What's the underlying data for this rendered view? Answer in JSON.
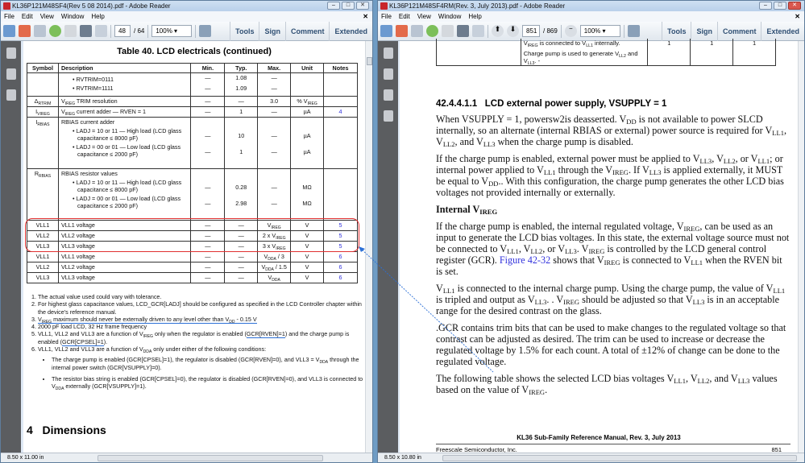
{
  "left_window": {
    "title": "KL36P121M48SF4(Rev 5 08 2014).pdf - Adobe Reader",
    "menu": [
      "File",
      "Edit",
      "View",
      "Window",
      "Help"
    ],
    "page_current": "48",
    "page_total": "/ 64",
    "zoom": "100%",
    "tool_buttons": [
      "Tools",
      "Sign",
      "Comment",
      "Extended"
    ],
    "page_size": "8.50 x 11.00 in",
    "table_title": "Table 40.  LCD electricals (continued)",
    "headers": [
      "Symbol",
      "Description",
      "Min.",
      "Typ.",
      "Max.",
      "Unit",
      "Notes"
    ],
    "rows": [
      {
        "sym": "",
        "desc": [
          "• RVTRIM=0111",
          "• RVTRIM=1111"
        ],
        "min": [
          "—",
          "—"
        ],
        "typ": [
          "1.08",
          "1.09"
        ],
        "max": [
          "—",
          "—"
        ],
        "unit": "",
        "note": ""
      },
      {
        "sym": "Δ_{RTRIM}",
        "desc": [
          "V_{IREG} TRIM resolution"
        ],
        "min": [
          "—"
        ],
        "typ": [
          "—"
        ],
        "max": [
          "3.0"
        ],
        "unit": "% V_{IREG}",
        "note": ""
      },
      {
        "sym": "I_{VIREG}",
        "desc": [
          "V_{IREG} current adder — RVEN = 1"
        ],
        "min": [
          "—"
        ],
        "typ": [
          "1"
        ],
        "max": [
          "—"
        ],
        "unit": "µA",
        "note": "4"
      },
      {
        "sym": "I_{RBIAS}",
        "desc": [
          "RBIAS current adder",
          "• LADJ = 10 or 11 — High load (LCD glass capacitance ≤ 8000 pF)",
          "• LADJ = 00 or 01 — Low load (LCD glass capacitance ≤ 2000 pF)"
        ],
        "min": [
          "—",
          "—"
        ],
        "typ": [
          "10",
          "1"
        ],
        "max": [
          "—",
          "—"
        ],
        "unit": [
          "µA",
          "µA"
        ],
        "note": ""
      },
      {
        "sym": "R_{RBIAS}",
        "desc": [
          "RBIAS resistor values",
          "• LADJ = 10 or 11 — High load (LCD glass capacitance ≤ 8000 pF)",
          "• LADJ = 00 or 01 — Low load (LCD glass capacitance ≤ 2000 pF)"
        ],
        "min": [
          "—",
          "—"
        ],
        "typ": [
          "0.28",
          "2.98"
        ],
        "max": [
          "—",
          "—"
        ],
        "unit": [
          "MΩ",
          "MΩ"
        ],
        "note": ""
      }
    ],
    "vll_rows": [
      {
        "sym": "VLL1",
        "desc": "VLL1 voltage",
        "min": "—",
        "typ": "—",
        "max": "V_{IREG}",
        "unit": "V",
        "note": "5"
      },
      {
        "sym": "VLL2",
        "desc": "VLL2 voltage",
        "min": "—",
        "typ": "—",
        "max": "2 x V_{IREG}",
        "unit": "V",
        "note": "5"
      },
      {
        "sym": "VLL3",
        "desc": "VLL3 voltage",
        "min": "—",
        "typ": "—",
        "max": "3 x V_{IREG}",
        "unit": "V",
        "note": "5"
      },
      {
        "sym": "VLL1",
        "desc": "VLL1 voltage",
        "min": "—",
        "typ": "—",
        "max": "V_{DDA} / 3",
        "unit": "V",
        "note": "6"
      },
      {
        "sym": "VLL2",
        "desc": "VLL2 voltage",
        "min": "—",
        "typ": "—",
        "max": "V_{DDA} / 1.5",
        "unit": "V",
        "note": "6"
      },
      {
        "sym": "VLL3",
        "desc": "VLL3 voltage",
        "min": "—",
        "typ": "—",
        "max": "V_{DDA}",
        "unit": "V",
        "note": "6"
      }
    ],
    "footnotes": [
      "The actual value used could vary with tolerance.",
      "For highest glass capacitance values, LCD_GCR[LADJ] should be configured as specified in the LCD Controller chapter within the device's reference manual.",
      "V_{IREG} maximum should never be externally driven to any level other than V_{DD} - 0.15 V",
      "2000 pF load LCD, 32 Hz frame frequency",
      "VLL1, VLL2 and VLL3 are a function of V_{IREG} only when the regulator is enabled (GCR[RVEN]=1) and the charge pump is enabled (GCR[CPSEL]=1).",
      "VLL1, VLL2 and VLL3 are a function of V_{DDA} only under either of the following conditions:"
    ],
    "footnote_bullets": [
      "The charge pump is enabled (GCR[CPSEL]=1), the regulator is disabled (GCR[RVEN]=0), and VLL3 = V_{DDA} through the internal power switch (GCR[VSUPPLY]=0).",
      "The resistor bias string is enabled (GCR[CPSEL]=0), the regulator is disabled (GCR[RVEN]=0), and VLL3 is connected to V_{DDA} externally (GCR[VSUPPLY]=1)."
    ],
    "section_heading": "4   Dimensions"
  },
  "right_window": {
    "title": "KL36P121M48SF4RM(Rev. 3, July 2013).pdf - Adobe Reader",
    "menu": [
      "File",
      "Edit",
      "View",
      "Window",
      "Help"
    ],
    "page_current": "851",
    "page_total": "/ 869",
    "zoom": "100%",
    "tool_buttons": [
      "Tools",
      "Sign",
      "Comment",
      "Extended"
    ],
    "page_size": "8.50 x 10.80 in",
    "top_table": {
      "desc1": "V_{IREG} is connected to V_{LL1} internally.",
      "desc2": "Charge pump is used to generate V_{LL2} and V_{LL3}. -",
      "vals": [
        "1",
        "1",
        "1"
      ]
    },
    "heading": "42.4.4.1.1   LCD external power supply, VSUPPLY = 1",
    "para1": "When VSUPPLY = 1, powersw2is deasserted. V_{DD} is not available to power SLCD internally, so an alternate (internal RBIAS or external) power source is required for V_{LL1}, V_{LL2}, and V_{LL3} when the charge pump is disabled.",
    "para2": "If the charge pump is enabled, external power must be applied to V_{LL3}, V_{LL2}, or V_{LL1}; or internal power applied to V_{LL1} through the V_{IREG}. If V_{LL3} is applied externally, it MUST be equal to V_{DD}.. With this configuration, the charge pump generates the other LCD bias voltages not provided internally or externally.",
    "subheading": "Internal V_{IREG}",
    "para3_a": "If the charge pump is enabled, the internal regulated voltage, V_{IREG}, can be used as an input to generate the LCD bias voltages. In this state, the external voltage source must not be connected to V_{LL1}, V_{LL2}, or V_{LL3}. V_{IREG} is controlled by the LCD general control register (GCR).",
    "para3_link": "Figure 42-32",
    "para3_b": "shows that V_{IREG} is connected to V_{LL1} when the RVEN bit is set.",
    "para4": "V_{LL1} is connected to the internal charge pump. Using the charge pump, the value of V_{LL1} is tripled and output as V_{LL3}. . V_{IREG} should be adjusted so that V_{LL3} is in an acceptable range for the desired contrast on the glass.",
    "para5": ".GCR contains trim bits that can be used to make changes to the regulated voltage so that contrast can be adjusted as desired. The trim can be used to increase or decrease the regulated voltage by 1.5% for each count. A total of ±12% of change can be done to the regulated voltage.",
    "para6": "The following table shows the selected LCD bias voltages V_{LL1}, V_{LL2}, and V_{LL3} values based on the value of V_{IREG}.",
    "footer_title": "KL36 Sub-Family Reference Manual, Rev. 3, July 2013",
    "footer_company": "Freescale Semiconductor, Inc.",
    "footer_page": "851"
  },
  "colors": {
    "highlight": "#e03030",
    "annotation": "#2b6fd6",
    "link": "#3333dd"
  }
}
